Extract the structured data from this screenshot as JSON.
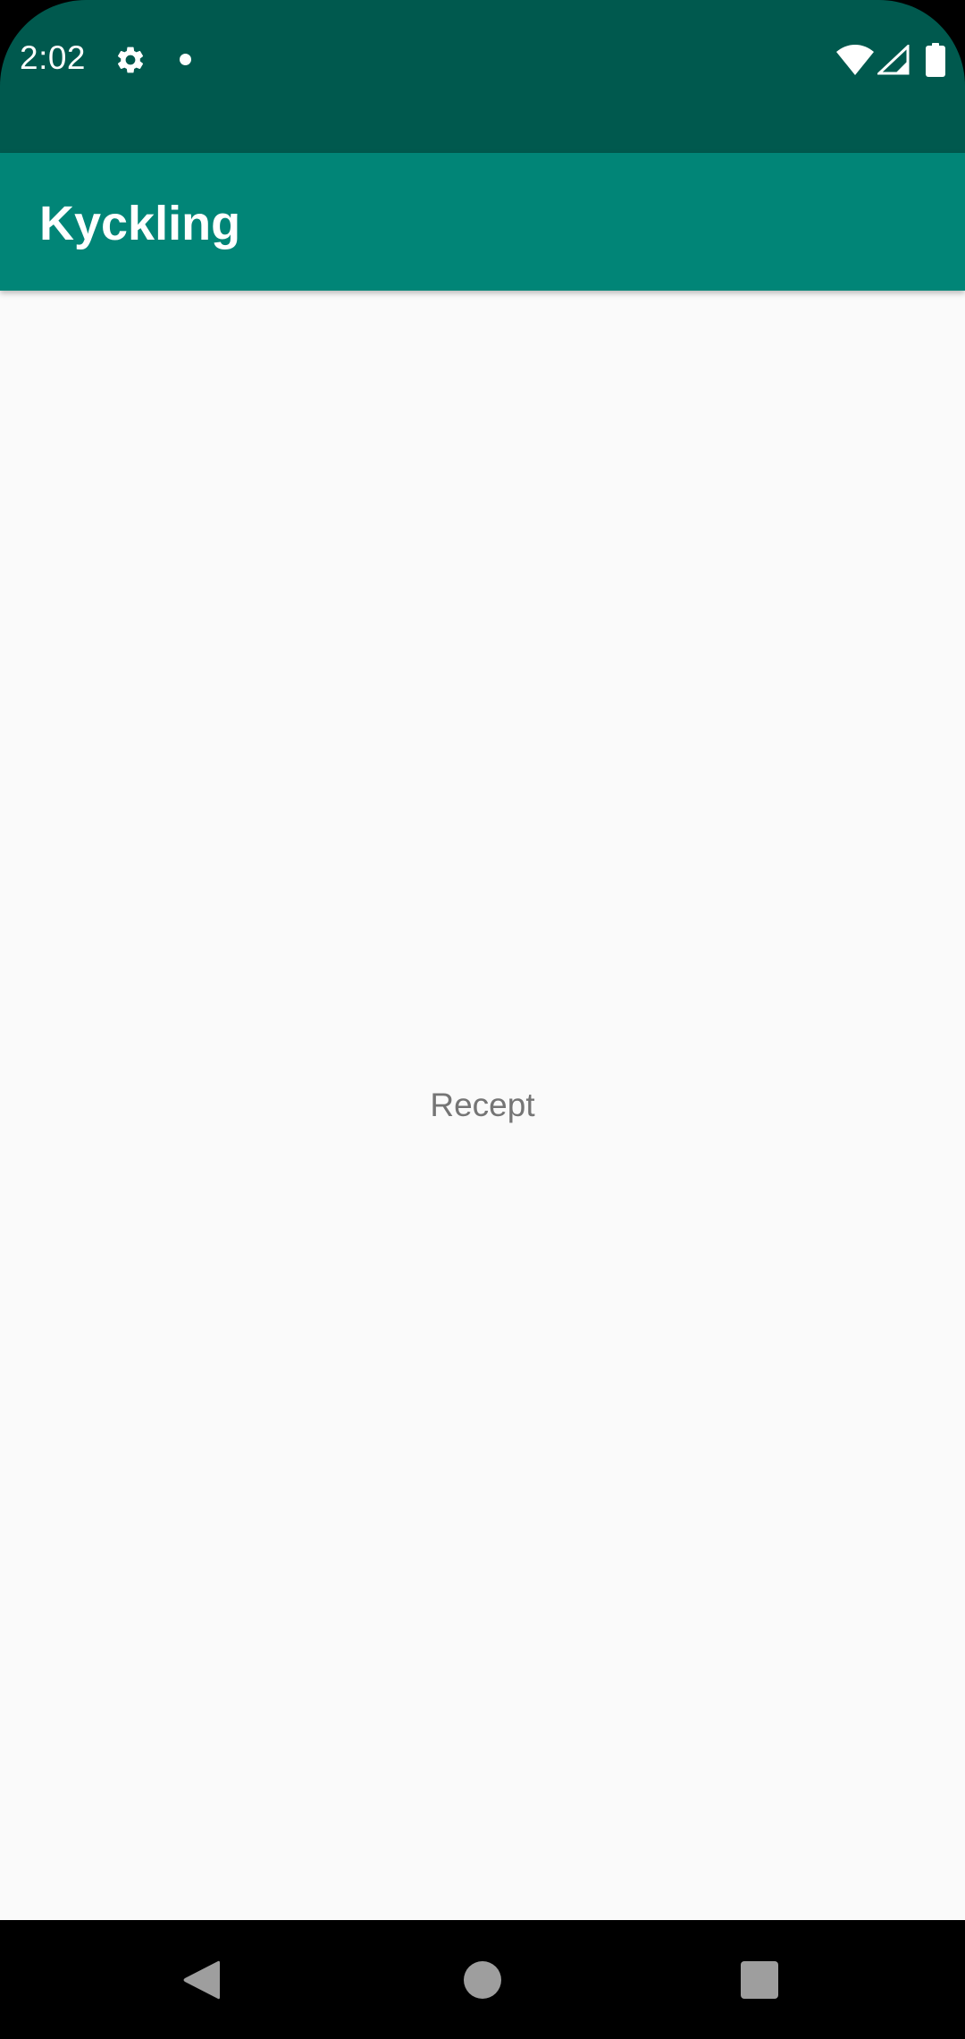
{
  "status_bar": {
    "time": "2:02",
    "icons": [
      "gear-icon",
      "notification-dot-icon",
      "wifi-icon",
      "cellular-signal-icon",
      "battery-icon"
    ],
    "background_color": "#00594E"
  },
  "app_bar": {
    "title": "Kyckling",
    "background_color": "#018577"
  },
  "main": {
    "center_label": "Recept",
    "background_color": "#FAFAFA"
  },
  "navigation_bar": {
    "buttons": [
      "back-icon",
      "home-icon",
      "recents-icon"
    ]
  }
}
